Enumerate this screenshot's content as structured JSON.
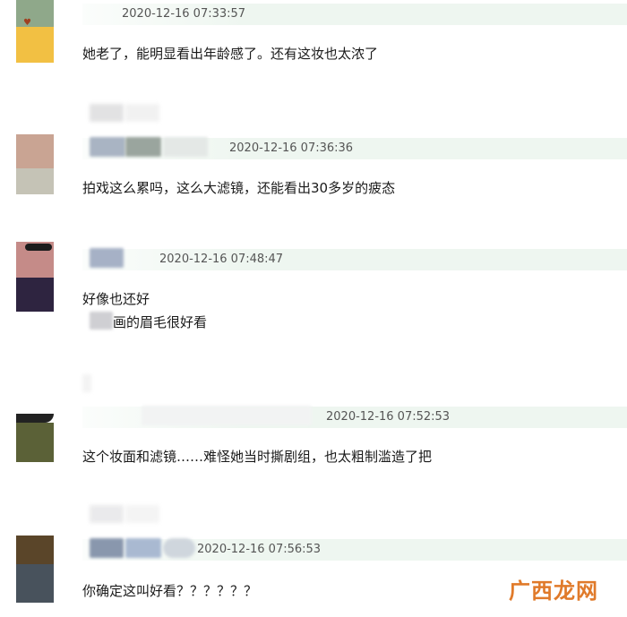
{
  "comments": [
    {
      "timestamp": "2020-12-16 07:33:57",
      "text": "她老了，能明显看出年龄感了。还有这妆也太浓了"
    },
    {
      "timestamp": "2020-12-16 07:36:36",
      "text": "拍戏这么累吗，这么大滤镜，还能看出30多岁的疲态"
    },
    {
      "timestamp": "2020-12-16 07:48:47",
      "text": "好像也还好",
      "text2": "画的眉毛很好看"
    },
    {
      "timestamp": "2020-12-16 07:52:53",
      "text": "这个妆面和滤镜……难怪她当时撕剧组，也太粗制滥造了把"
    },
    {
      "timestamp": "2020-12-16 07:56:53",
      "text": "你确定这叫好看？？？？？？"
    }
  ],
  "watermark": "广西龙网"
}
